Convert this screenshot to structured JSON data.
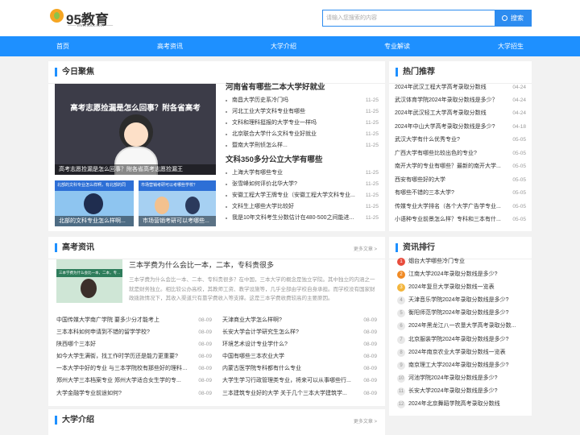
{
  "brand": {
    "name": "95教育",
    "sub": "—— www.95cc.com ——"
  },
  "search": {
    "placeholder": "请输入您搜索的内容",
    "button": "搜索"
  },
  "nav": [
    "首页",
    "高考资讯",
    "大学介绍",
    "专业解读",
    "大学招生"
  ],
  "focus": {
    "title": "今日聚焦",
    "main_img": {
      "headline": "高考志愿捡漏是怎么回事？附各省高考",
      "caption": "高考志愿捡漏是怎么回事？附各省高考志愿捡漏王"
    },
    "small_imgs": [
      {
        "banner": "北部的文科专业怎么样啊，有北部的同",
        "caption": "北部的文科专业怎么样啊..."
      },
      {
        "banner": "市场营销考研可以考哪些学校？",
        "caption": "市场营销考研可以考哪些..."
      }
    ],
    "groups": [
      {
        "title": "河南省有哪些二本大学好就业",
        "items": [
          {
            "t": "南昌大学历史系冷门吗",
            "d": "11-25"
          },
          {
            "t": "河北工业大学文科专业有哪些",
            "d": "11-25"
          },
          {
            "t": "文科和理科挺报的大学专业一样吗",
            "d": "11-25"
          },
          {
            "t": "北京联合大学什么文科专业好就业",
            "d": "11-25"
          },
          {
            "t": "暨南大学刑侦怎么样...",
            "d": "11-25"
          }
        ]
      },
      {
        "title": "文科350多分公立大学有哪些",
        "items": [
          {
            "t": "上海大学有哪些专业",
            "d": "11-25"
          },
          {
            "t": "张雪峰如何评价北华大学?",
            "d": "11-25"
          },
          {
            "t": "安徽工程大学王牌专业（安徽工程大学文科专业...",
            "d": "11-25"
          },
          {
            "t": "文科生上哪些大学比较好",
            "d": "11-25"
          },
          {
            "t": "我是10年文科考生分数估计在480-500之间能进...",
            "d": "11-25"
          }
        ]
      }
    ]
  },
  "hot": {
    "title": "热门推荐",
    "items": [
      {
        "t": "2024年武汉工程大学高考录取分数线",
        "d": "04-24"
      },
      {
        "t": "武汉体育学院2024年录取分数线是多少？",
        "d": "04-24"
      },
      {
        "t": "2024年武汉轻工大学高考录取分数线",
        "d": "04-24"
      },
      {
        "t": "2024年中山大学高考录取分数线是多少?",
        "d": "04-18"
      },
      {
        "t": "武汉大学有什么优秀专业?",
        "d": "05-05"
      },
      {
        "t": "广西大学有哪些比较出色的专业?",
        "d": "05-05"
      },
      {
        "t": "南开大学的专业有哪些？最新的南开大学...",
        "d": "05-05"
      },
      {
        "t": "西安有哪些好的大学",
        "d": "05-05"
      },
      {
        "t": "有哪些不错的三本大学?",
        "d": "05-05"
      },
      {
        "t": "传媒专业大学排名（各个大学广告学专业...",
        "d": "05-05"
      },
      {
        "t": "小语种专业前景怎么样？专科和三本有什...",
        "d": "05-05"
      }
    ]
  },
  "news": {
    "title": "高考资讯",
    "more": "更多文章 >",
    "feature": {
      "banner": "三本学费为什么会比一本，二本，专科贵很多",
      "title": "三本学费为什么会比一本，二本，专科贵很多",
      "desc": "三本学费为什么会比一本、二本、专科贵很多？在中国，三本大学的概念是独立学院。其中独立的内涵之一就是财务独立。相比较公办高校，其教师工资、教学设施等，几乎全部由学校自身承担。而学校没有国家财政拨款情况下，其收入渠道只有靠学费收入等支撑。这是三本学费收费较高的主要原因。"
    },
    "left": [
      {
        "t": "中国传媒大学南广学院 要多少分才能考上",
        "d": "08-09"
      },
      {
        "t": "三本本科如何申请到不错的留学学校?",
        "d": "08-09"
      },
      {
        "t": "陕西哪个三本好",
        "d": "08-09"
      },
      {
        "t": "如今大学生满街，找工作时学历还是能力更重要?",
        "d": "08-09"
      },
      {
        "t": "一本大学中好的专业 与三本学院校有那些好的理科专业?",
        "d": "08-09"
      },
      {
        "t": "郑州大学三本档案专业 郑州大学适合女生学的专...",
        "d": "08-09"
      },
      {
        "t": "大学金融学专业前途如何?",
        "d": "08-09"
      }
    ],
    "right": [
      {
        "t": "天津商业大学怎么样啊?",
        "d": "08-09"
      },
      {
        "t": "长安大学会计学研究生怎么样?",
        "d": "08-09"
      },
      {
        "t": "环境艺术设计专业学什么?",
        "d": "08-09"
      },
      {
        "t": "中国有哪些三本农业大学",
        "d": "08-09"
      },
      {
        "t": "内蒙古医学院专科都有什么专业",
        "d": "08-09"
      },
      {
        "t": "大学生学习行政管理类专业，将来可以从事哪些行...",
        "d": "08-09"
      },
      {
        "t": "三本建筑专业好的大学 关于几个三本大学建筑学...",
        "d": "08-09"
      }
    ]
  },
  "ranking": {
    "title": "资讯排行",
    "items": [
      "烟台大学哪些冷门专业",
      "江南大学2024年录取分数线是多少?",
      "2024年复旦大学录取分数线一览表",
      "天津音乐学院2024年录取分数线是多少?",
      "衡阳师范学院2024年录取分数线是多少?",
      "2024年黑龙江八一农垦大学高考录取分数...",
      "北京服装学院2024年录取分数线是多少?",
      "2024年南京农业大学录取分数线一览表",
      "南京理工大学2024年录取分数线是多少?",
      "河池学院2024年录取分数线是多少?",
      "长安大学2024年录取分数线是多少?",
      "2024年北京舞蹈学院高考录取分数线"
    ]
  },
  "university": {
    "title": "大学介绍",
    "more": "更多文章 >"
  },
  "colors": {
    "accent": "#1e90ff",
    "rank1": "#e84c3d",
    "rank2": "#f08a24",
    "rank3": "#f3b53c"
  }
}
